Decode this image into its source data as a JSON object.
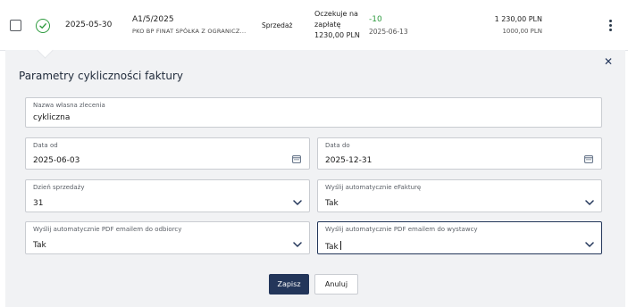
{
  "invoice_row": {
    "date": "2025-05-30",
    "document_number": "A1/5/2025",
    "client": "PKO BP FINAT SPÓŁKA Z OGRANICZ...",
    "type": "Sprzedaż",
    "status_line1": "Oczekuje na",
    "status_line2": "zapłatę",
    "status_line3": "1230,00 PLN",
    "days": "-10",
    "due_date": "2025-06-13",
    "gross_amount": "1 230,00 PLN",
    "net_amount": "1000,00 PLN",
    "status_icon": "check-circle-icon",
    "status_color": "#2e9b3f"
  },
  "panel": {
    "title": "Parametry cykliczności faktury",
    "close_icon": "close-icon",
    "fields": {
      "custom_name": {
        "label": "Nazwa własna zlecenia",
        "value": "cykliczna"
      },
      "date_from": {
        "label": "Data od",
        "value": "2025-06-03"
      },
      "date_to": {
        "label": "Data do",
        "value": "2025-12-31"
      },
      "sale_day": {
        "label": "Dzień sprzedaży",
        "value": "31"
      },
      "auto_efaktura": {
        "label": "Wyślij automatycznie eFakturę",
        "value": "Tak"
      },
      "auto_pdf_recipient": {
        "label": "Wyślij automatycznie PDF emailem do odbiorcy",
        "value": "Tak"
      },
      "auto_pdf_issuer": {
        "label": "Wyślij automatycznie PDF emailem do wystawcy",
        "value": "Tak"
      }
    },
    "buttons": {
      "save": "Zapisz",
      "cancel": "Anuluj"
    }
  },
  "colors": {
    "accent": "#23365a",
    "success": "#2e9b3f",
    "panel_bg": "#f1f2f4"
  }
}
